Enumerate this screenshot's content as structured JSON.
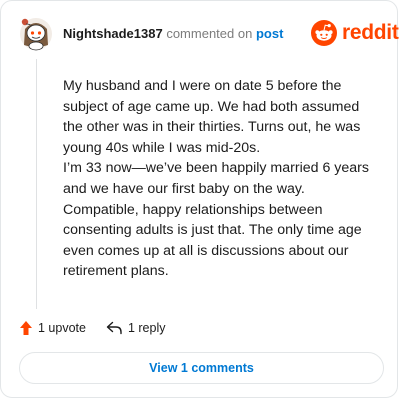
{
  "header": {
    "username": "Nightshade1387",
    "commented_text": "commented on",
    "post_link": "post",
    "avatar_icon": "snoo-avatar-icon",
    "brand_logo_icon": "reddit-snoo-icon",
    "brand_name": "reddit",
    "brand_color": "#ff4500"
  },
  "comment": {
    "paragraphs": [
      "My husband and I were on date 5 before the subject of age came up. We had both assumed the other was in their thirties. Turns out, he was young 40s while I was mid-20s.",
      "I’m 33 now—we’ve been happily married 6 years and we have our first baby on the way. Compatible, happy relationships between consenting adults is just that. The only time age even comes up at all is discussions about our retirement plans."
    ]
  },
  "actions": {
    "upvote_icon": "upvote-arrow-icon",
    "upvote_label": "1 upvote",
    "upvote_color": "#ff4500",
    "reply_icon": "reply-arrow-icon",
    "reply_label": "1 reply"
  },
  "footer": {
    "view_comments_label": "View 1 comments",
    "link_color": "#0079d3"
  }
}
